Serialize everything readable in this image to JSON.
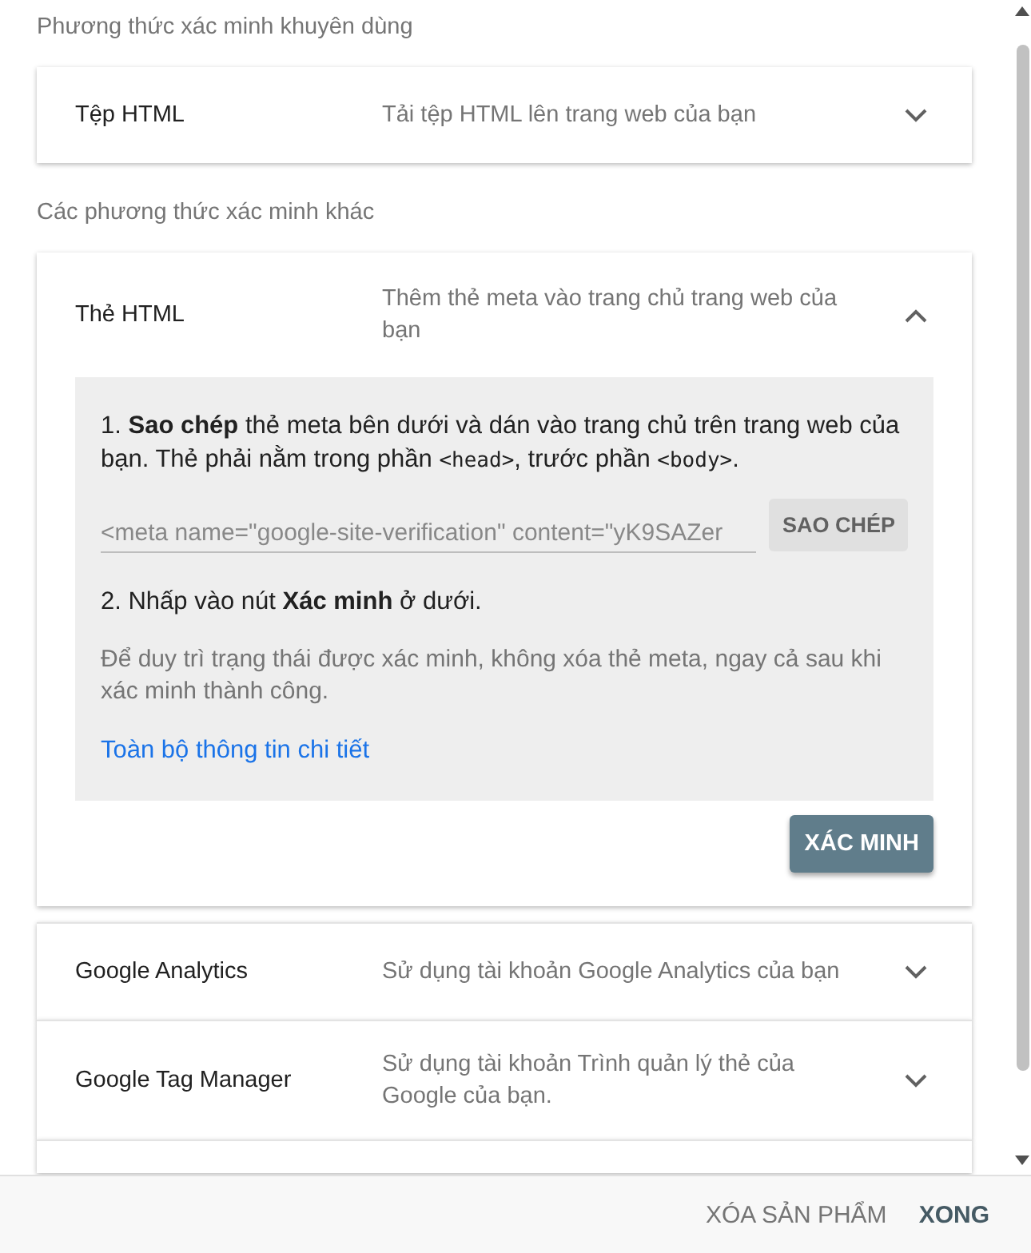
{
  "sections": [
    {
      "heading": "Phương thức xác minh khuyên dùng",
      "cards": [
        {
          "title": "Tệp HTML",
          "description": "Tải tệp HTML lên trang web của bạn",
          "expanded": false
        }
      ]
    },
    {
      "heading": "Các phương thức xác minh khác",
      "cards": [
        {
          "title": "Thẻ HTML",
          "description": "Thêm thẻ meta vào trang chủ trang web của bạn",
          "expanded": true,
          "details": {
            "step1": [
              {
                "kind": "text",
                "text": "1. **Sao chép** thẻ meta bên dưới và dán vào trang chủ trên trang web của bạn. Thẻ phải nằm trong phần "
              },
              {
                "kind": "code",
                "text": "<head>"
              },
              {
                "kind": "text",
                "text": ", trước phần "
              },
              {
                "kind": "code",
                "text": "<body>"
              },
              {
                "kind": "text",
                "text": "."
              }
            ],
            "meta_value": "<meta name=\"google-site-verification\" content=\"yK9SAZer",
            "copy_button": "SAO CHÉP",
            "step2": "2. Nhấp vào nút **Xác minh** ở dưới.",
            "note": "Để duy trì trạng thái được xác minh, không xóa thẻ meta, ngay cả sau khi xác minh thành công.",
            "link": "Toàn bộ thông tin chi tiết",
            "verify_button": "XÁC MINH"
          }
        },
        {
          "title": "Google Analytics",
          "description": "Sử dụng tài khoản Google Analytics của bạn",
          "expanded": false
        },
        {
          "title": "Google Tag Manager",
          "description": "Sử dụng tài khoản Trình quản lý thẻ của Google của bạn.",
          "expanded": false
        }
      ]
    }
  ],
  "footer": {
    "buttons": [
      "XÓA SẢN PHẨM",
      "XONG"
    ]
  }
}
